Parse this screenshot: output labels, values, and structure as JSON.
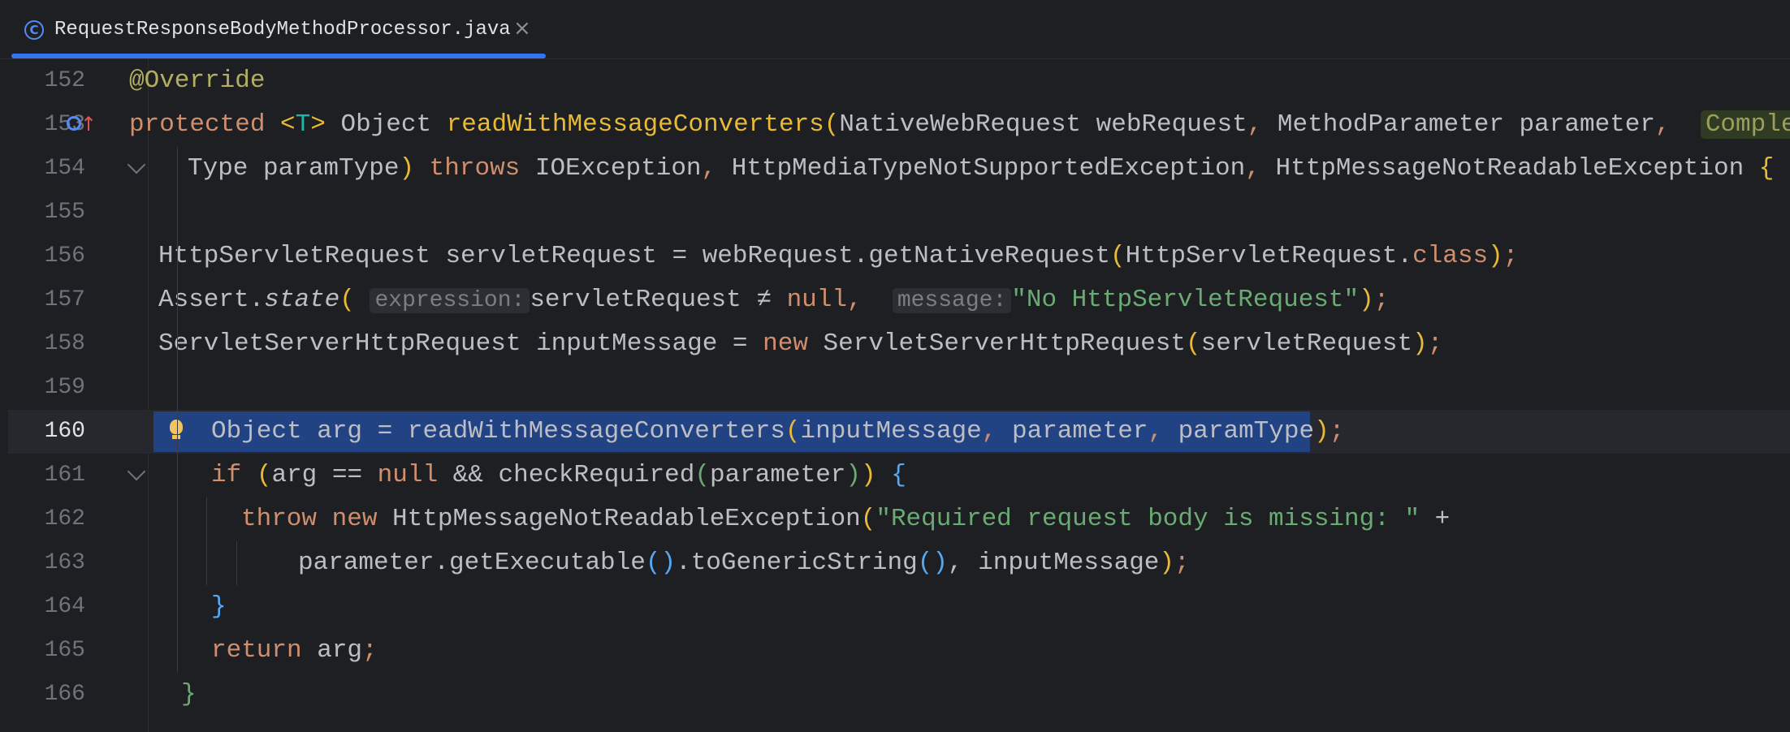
{
  "tab": {
    "title": "RequestResponseBodyMethodProcessor.java",
    "close_label": "×",
    "icon": "class-icon"
  },
  "editor": {
    "current_line": 160,
    "lines": [
      {
        "num": "152"
      },
      {
        "num": "153"
      },
      {
        "num": "154"
      },
      {
        "num": "155"
      },
      {
        "num": "156"
      },
      {
        "num": "157"
      },
      {
        "num": "158"
      },
      {
        "num": "159"
      },
      {
        "num": "160"
      },
      {
        "num": "161"
      },
      {
        "num": "162"
      },
      {
        "num": "163"
      },
      {
        "num": "164"
      },
      {
        "num": "165"
      },
      {
        "num": "166"
      }
    ],
    "code": {
      "l152": {
        "annotation": "@Override"
      },
      "l153": {
        "kw": "protected",
        "open": "<",
        "tparam": "T",
        "close": ">",
        "rtype": " Object ",
        "method": "readWithMessageConverters",
        "paren": "(",
        "p1type": "NativeWebRequest webRequest",
        "comma1": ", ",
        "p2type": "MethodParameter parameter",
        "comma2": ",",
        "hint": "Complex"
      },
      "l154": {
        "text": "Type paramType",
        "paren": ")",
        "kw": " throws ",
        "e1": "IOException",
        "c1": ", ",
        "e2": "HttpMediaTypeNotSupportedException",
        "c2": ", ",
        "e3": "HttpMessageNotReadableException",
        "brace": " {"
      },
      "l156": {
        "a": "HttpServletRequest servletRequest = webRequest.getNativeRequest",
        "p": "(",
        "b": "HttpServletRequest.",
        "kw": "class",
        "c": ")",
        "semi": ";"
      },
      "l157": {
        "a": "Assert.",
        "m": "state",
        "p": "(",
        "hint1": "expression:",
        "b": "servletRequest ≠ ",
        "kw": "null",
        "comma": ",",
        "hint2": "message:",
        "str": "\"No HttpServletRequest\"",
        "c": ")",
        "semi": ";"
      },
      "l158": {
        "a": "ServletServerHttpRequest inputMessage = ",
        "kw": "new",
        "b": " ServletServerHttpRequest",
        "p": "(",
        "c": "servletRequest",
        "d": ")",
        "semi": ";"
      },
      "l160": {
        "a": "Object arg = readWithMessageConverters",
        "p": "(",
        "b": "inputMessage",
        "c1": ", ",
        "c": "parameter",
        "c2": ", ",
        "d": "paramType",
        "e": ")",
        "semi": ";"
      },
      "l161": {
        "kw": "if",
        "sp": " ",
        "p": "(",
        "a": "arg == ",
        "kw2": "null",
        "b": " && checkRequired",
        "p2": "(",
        "c": "parameter",
        "d": ")",
        "e": ")",
        "brace": " {"
      },
      "l162": {
        "kw": "throw",
        "kw2": " new",
        "a": " HttpMessageNotReadableException",
        "p": "(",
        "str": "\"Required request body is missing: \"",
        "b": " +"
      },
      "l163": {
        "a": "parameter.getExecutable",
        "p": "()",
        "b": ".toGenericString",
        "p2": "()",
        "c": ", inputMessage",
        "d": ")",
        "semi": ";"
      },
      "l164": {
        "brace": "}"
      },
      "l165": {
        "kw": "return",
        "a": " arg",
        "semi": ";"
      },
      "l166": {
        "brace": "}"
      }
    }
  }
}
